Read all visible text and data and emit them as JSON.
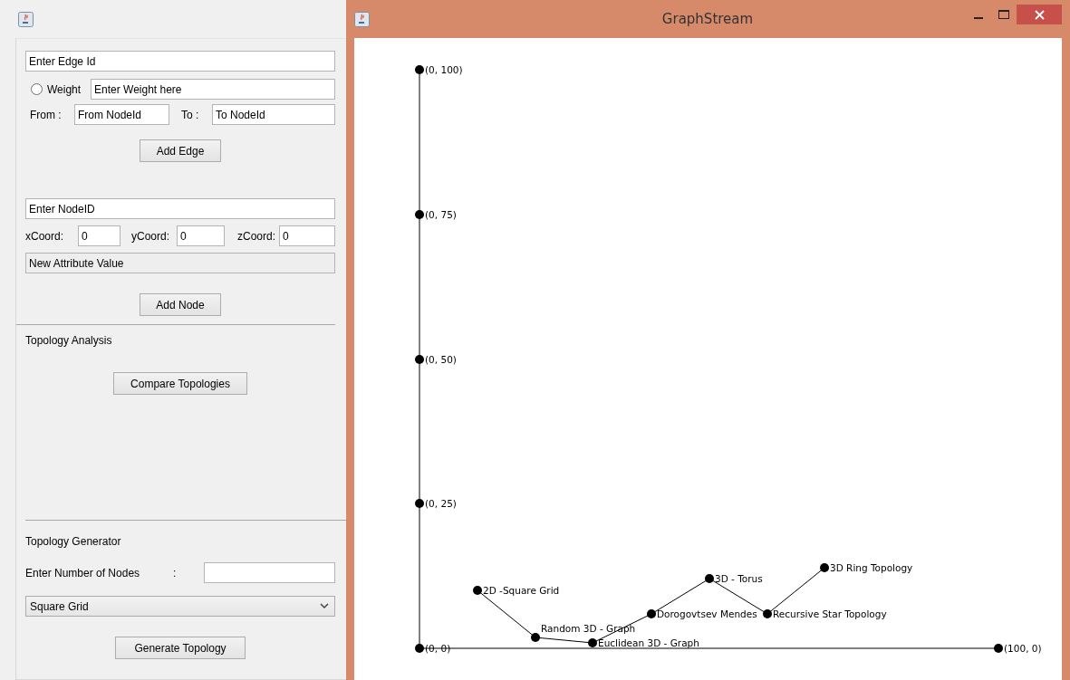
{
  "left_window": {
    "edge_form": {
      "edge_id": {
        "value": "Enter Edge Id"
      },
      "weight_radio": {
        "label": "Weight",
        "selected": false
      },
      "weight_field": {
        "value": "Enter Weight here"
      },
      "from_label": "From :",
      "from_field": {
        "value": "From NodeId"
      },
      "to_label": "To :",
      "to_field": {
        "value": "To NodeId"
      },
      "button": "Add Edge"
    },
    "node_form": {
      "node_id": {
        "value": "Enter NodeID"
      },
      "coords": [
        {
          "label": "xCoord:",
          "value": "0"
        },
        {
          "label": "yCoord:",
          "value": "0"
        },
        {
          "label": "zCoord:",
          "value": "0"
        }
      ],
      "attribute_field": {
        "value": "New Attribute Value",
        "disabled": true
      },
      "button": "Add Node"
    },
    "analysis": {
      "title": "Topology Analysis",
      "button": "Compare Topologies"
    },
    "generator": {
      "title": "Topology Generator",
      "nodes_label": "Enter Number of Nodes",
      "colon": ":",
      "dropdown": "Square Grid",
      "button": "Generate Topology"
    }
  },
  "graph_window": {
    "title": "GraphStream",
    "nodes": [
      {
        "label": "(0, 100)"
      },
      {
        "label": "(0, 75)"
      },
      {
        "label": "(0, 50)"
      },
      {
        "label": "(0, 25)"
      },
      {
        "label": "3D Ring Topology"
      },
      {
        "label": "3D - Torus"
      },
      {
        "label": "2D -Square Grid"
      },
      {
        "label": "Dorogovtsev Mendes"
      },
      {
        "label": "Recursive Star Topology"
      },
      {
        "label": "Random 3D - Graph"
      },
      {
        "label": "Euclidean 3D - Graph"
      },
      {
        "label": "(0, 0)"
      },
      {
        "label": "(100, 0)"
      }
    ]
  }
}
